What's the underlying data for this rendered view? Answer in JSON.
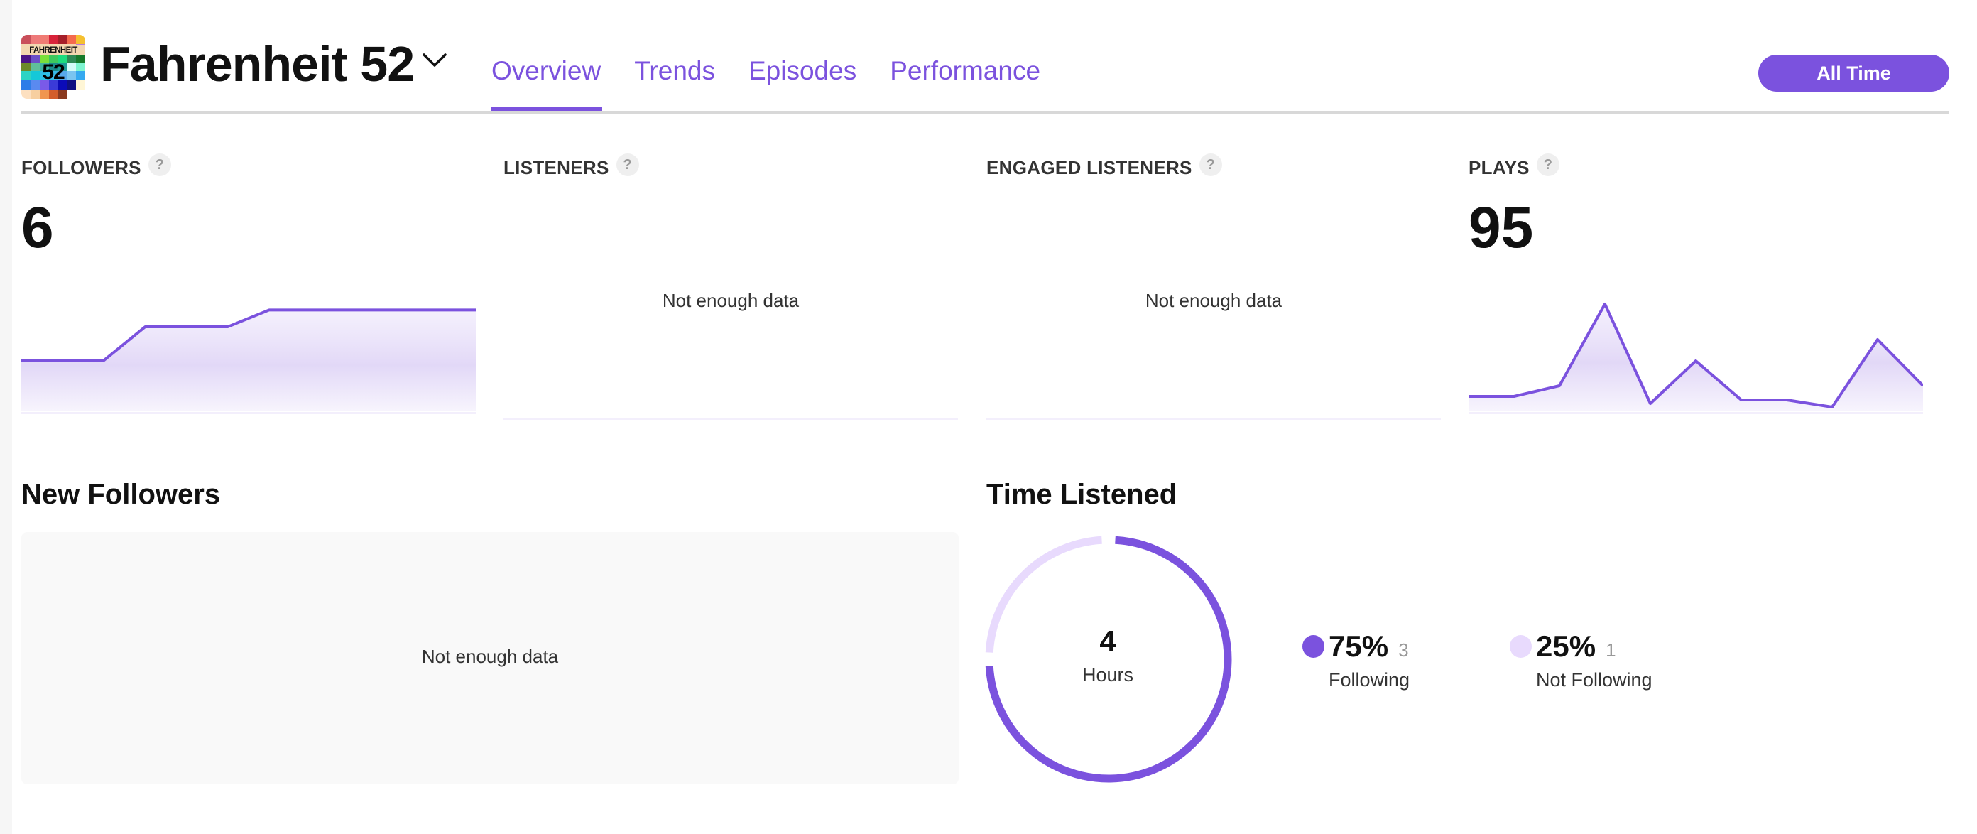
{
  "header": {
    "podcast_title": "Fahrenheit 52",
    "logo": {
      "text_top": "FAHRENHEIT",
      "text_number": "52",
      "grid_colors": [
        [
          "#c94f5a",
          "#ee7a7a",
          "#f07c74",
          "#d8233a",
          "#a51f2a",
          "#f46a4e",
          "#f5c030"
        ],
        [
          "#f3d7b0",
          "#f3d7b0",
          "#f3d7b0",
          "#f3d7b0",
          "#f3d7b0",
          "#f3d7b0",
          "#b77bdc"
        ],
        [
          "#4a1486",
          "#6a4fc8",
          "#7adf3a",
          "#3ec85e",
          "#1ddc7e",
          "#2e8a55",
          "#167a2a"
        ],
        [
          "#6b8a2a",
          "#5fbf9a",
          "#3fb39f",
          "#1a8a8a",
          "#1e9c98",
          "#d4fbf8",
          "#7ef5d0"
        ],
        [
          "#2dd4c4",
          "#14c8d8",
          "#2ec0e6",
          "#38b8e8",
          "#58a8ec",
          "#7ac4f0",
          "#35a9f0"
        ],
        [
          "#2d7de8",
          "#5a8af0",
          "#7a5ae8",
          "#3b3bd8",
          "#0b0bb8",
          "#101080",
          "#fff6d6"
        ],
        [
          "#fde0c0",
          "#f7cfa0",
          "#f0954f",
          "#d35d2a",
          "#8a3a20",
          "#ffffff",
          "#ffffff"
        ]
      ]
    },
    "tabs": [
      {
        "label": "Overview",
        "active": true
      },
      {
        "label": "Trends",
        "active": false
      },
      {
        "label": "Episodes",
        "active": false
      },
      {
        "label": "Performance",
        "active": false
      }
    ],
    "date_range_button": "All Time"
  },
  "colors": {
    "accent": "#7b52de",
    "accent_light": "#e8dafd",
    "area_fill": "#e4dbf7"
  },
  "stats": [
    {
      "label": "FOLLOWERS",
      "help": "?",
      "value": "6",
      "no_data": null
    },
    {
      "label": "LISTENERS",
      "help": "?",
      "value": null,
      "no_data": "Not enough data"
    },
    {
      "label": "ENGAGED LISTENERS",
      "help": "?",
      "value": null,
      "no_data": "Not enough data"
    },
    {
      "label": "PLAYS",
      "help": "?",
      "value": "95",
      "no_data": null
    }
  ],
  "new_followers": {
    "title": "New Followers",
    "no_data": "Not enough data"
  },
  "time_listened": {
    "title": "Time Listened",
    "total_value": "4",
    "total_unit": "Hours",
    "segments": [
      {
        "label": "Following",
        "percent_text": "75%",
        "count": "3",
        "fraction": 0.75,
        "color": "#7b52de"
      },
      {
        "label": "Not Following",
        "percent_text": "25%",
        "count": "1",
        "fraction": 0.25,
        "color": "#e8dafd"
      }
    ]
  },
  "chart_data": [
    {
      "type": "area",
      "title": "FOLLOWERS",
      "x": [
        1,
        2,
        3,
        4,
        5,
        6,
        7,
        8,
        9,
        10,
        11,
        12
      ],
      "values": [
        3,
        3,
        3,
        5,
        5,
        5,
        6,
        6,
        6,
        6,
        6,
        6
      ],
      "ylim": [
        0,
        7.2
      ],
      "grid": false,
      "legend": "none"
    },
    {
      "type": "area",
      "title": "PLAYS",
      "x": [
        1,
        2,
        3,
        4,
        5,
        6,
        7,
        8,
        9,
        10,
        11,
        12
      ],
      "values": [
        4,
        4,
        4,
        7,
        30,
        2,
        14,
        3,
        3,
        1,
        20,
        7
      ],
      "visible_from_index": 1,
      "ylim": [
        0,
        34
      ],
      "grid": false,
      "legend": "none"
    },
    {
      "type": "pie",
      "title": "Time Listened",
      "categories": [
        "Following",
        "Not Following"
      ],
      "values": [
        3,
        1
      ],
      "percent": [
        75,
        25
      ],
      "center_label": "4 Hours",
      "legend": "right"
    }
  ]
}
